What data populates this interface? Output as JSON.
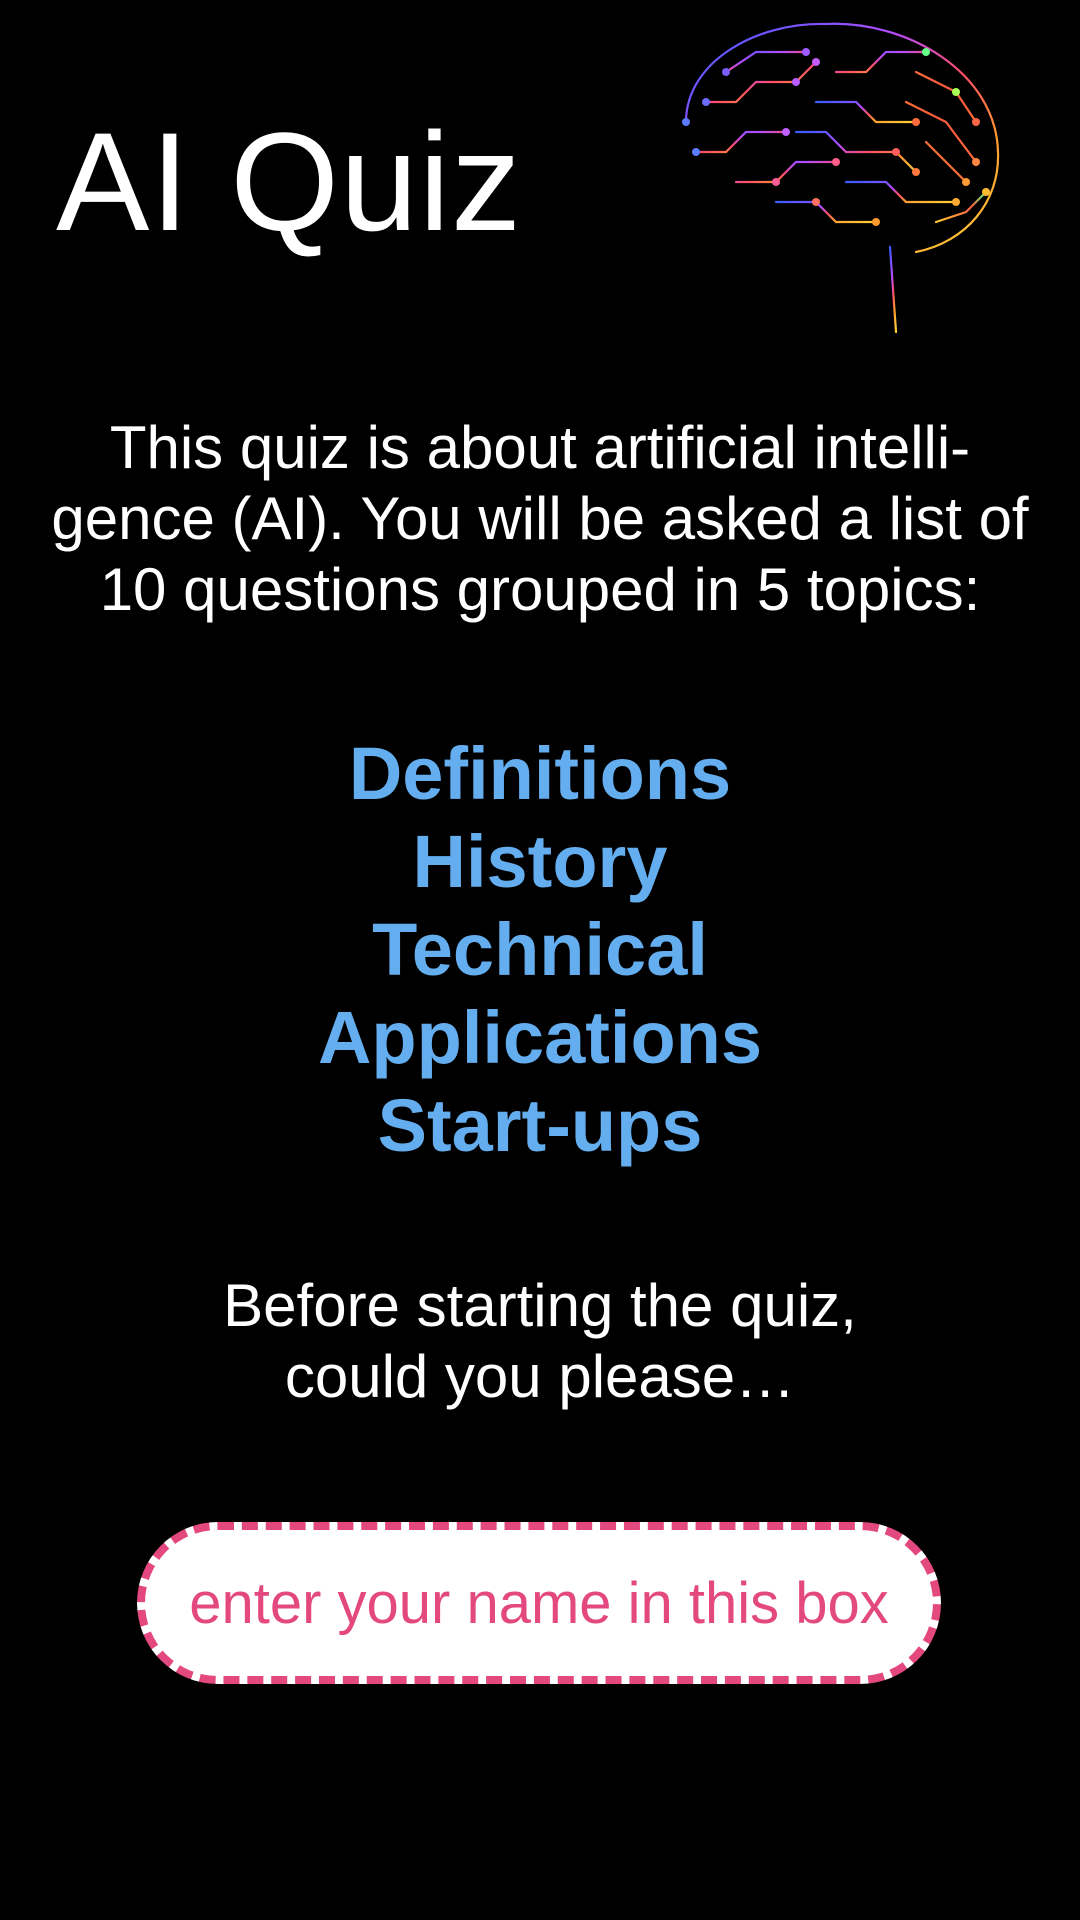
{
  "header": {
    "title": "AI Quiz",
    "logo_icon": "circuit-brain-icon"
  },
  "intro": {
    "text": "This quiz is about artificial intelli-gence (AI). You will be asked a list of 10 questions grouped in 5 topics:"
  },
  "topics": [
    {
      "label": "Definitions"
    },
    {
      "label": "History"
    },
    {
      "label": "Technical"
    },
    {
      "label": "Applications"
    },
    {
      "label": "Start-ups"
    }
  ],
  "prompt": {
    "line1": "Before starting the quiz,",
    "line2": "could you please…"
  },
  "name_field": {
    "placeholder": "enter your name in this box",
    "value": ""
  },
  "colors": {
    "background": "#000000",
    "text": "#ffffff",
    "topic_accent": "#64aef0",
    "input_accent": "#e3487f"
  }
}
